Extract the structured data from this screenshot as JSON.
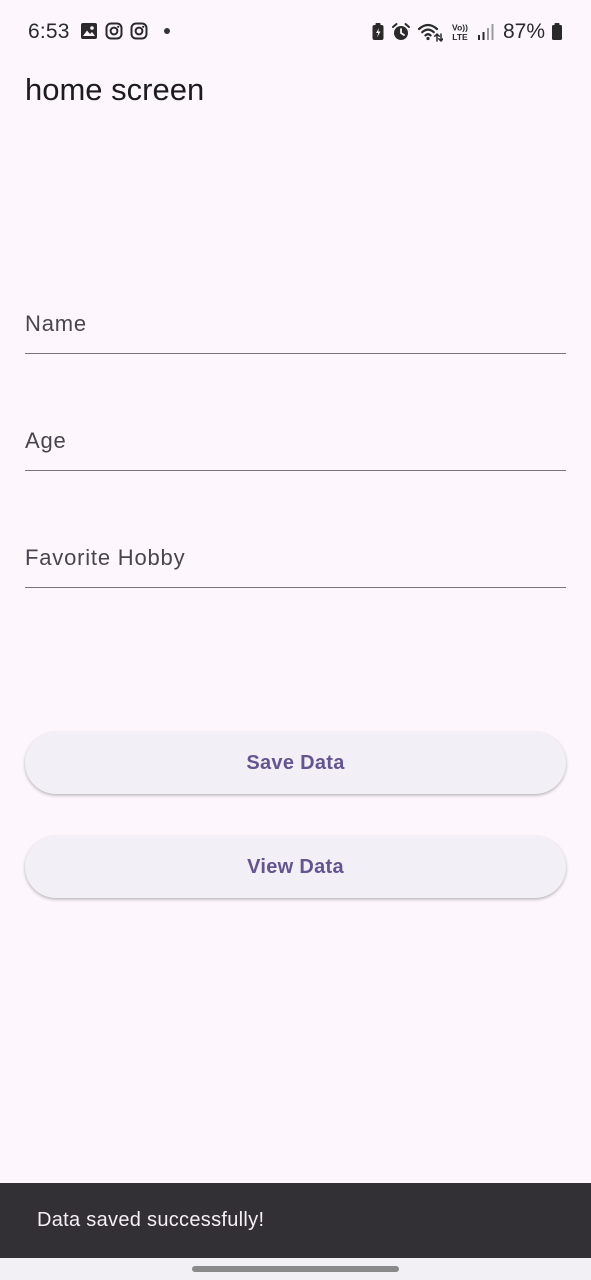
{
  "status_bar": {
    "time": "6:53",
    "left_icons": [
      "gallery-icon",
      "instagram-icon",
      "instagram-icon",
      "notification-dot"
    ],
    "right_icons": [
      "battery-saver-icon",
      "alarm-icon",
      "wifi-icon",
      "volte-icon",
      "signal-icon",
      "battery-icon"
    ],
    "volte_label_top": "Vo))",
    "volte_label_bottom": "LTE",
    "battery_percent": "87%"
  },
  "app_bar": {
    "title": "home screen"
  },
  "form": {
    "fields": [
      {
        "placeholder": "Name",
        "value": ""
      },
      {
        "placeholder": "Age",
        "value": ""
      },
      {
        "placeholder": "Favorite Hobby",
        "value": ""
      }
    ]
  },
  "buttons": {
    "save_label": "Save Data",
    "view_label": "View Data"
  },
  "snackbar": {
    "message": "Data saved successfully!"
  },
  "colors": {
    "background": "#fdf7fd",
    "button_text": "#65558f",
    "button_bg": "#f3eff6",
    "snackbar_bg": "#322f35",
    "snackbar_text": "#f5eff7"
  }
}
